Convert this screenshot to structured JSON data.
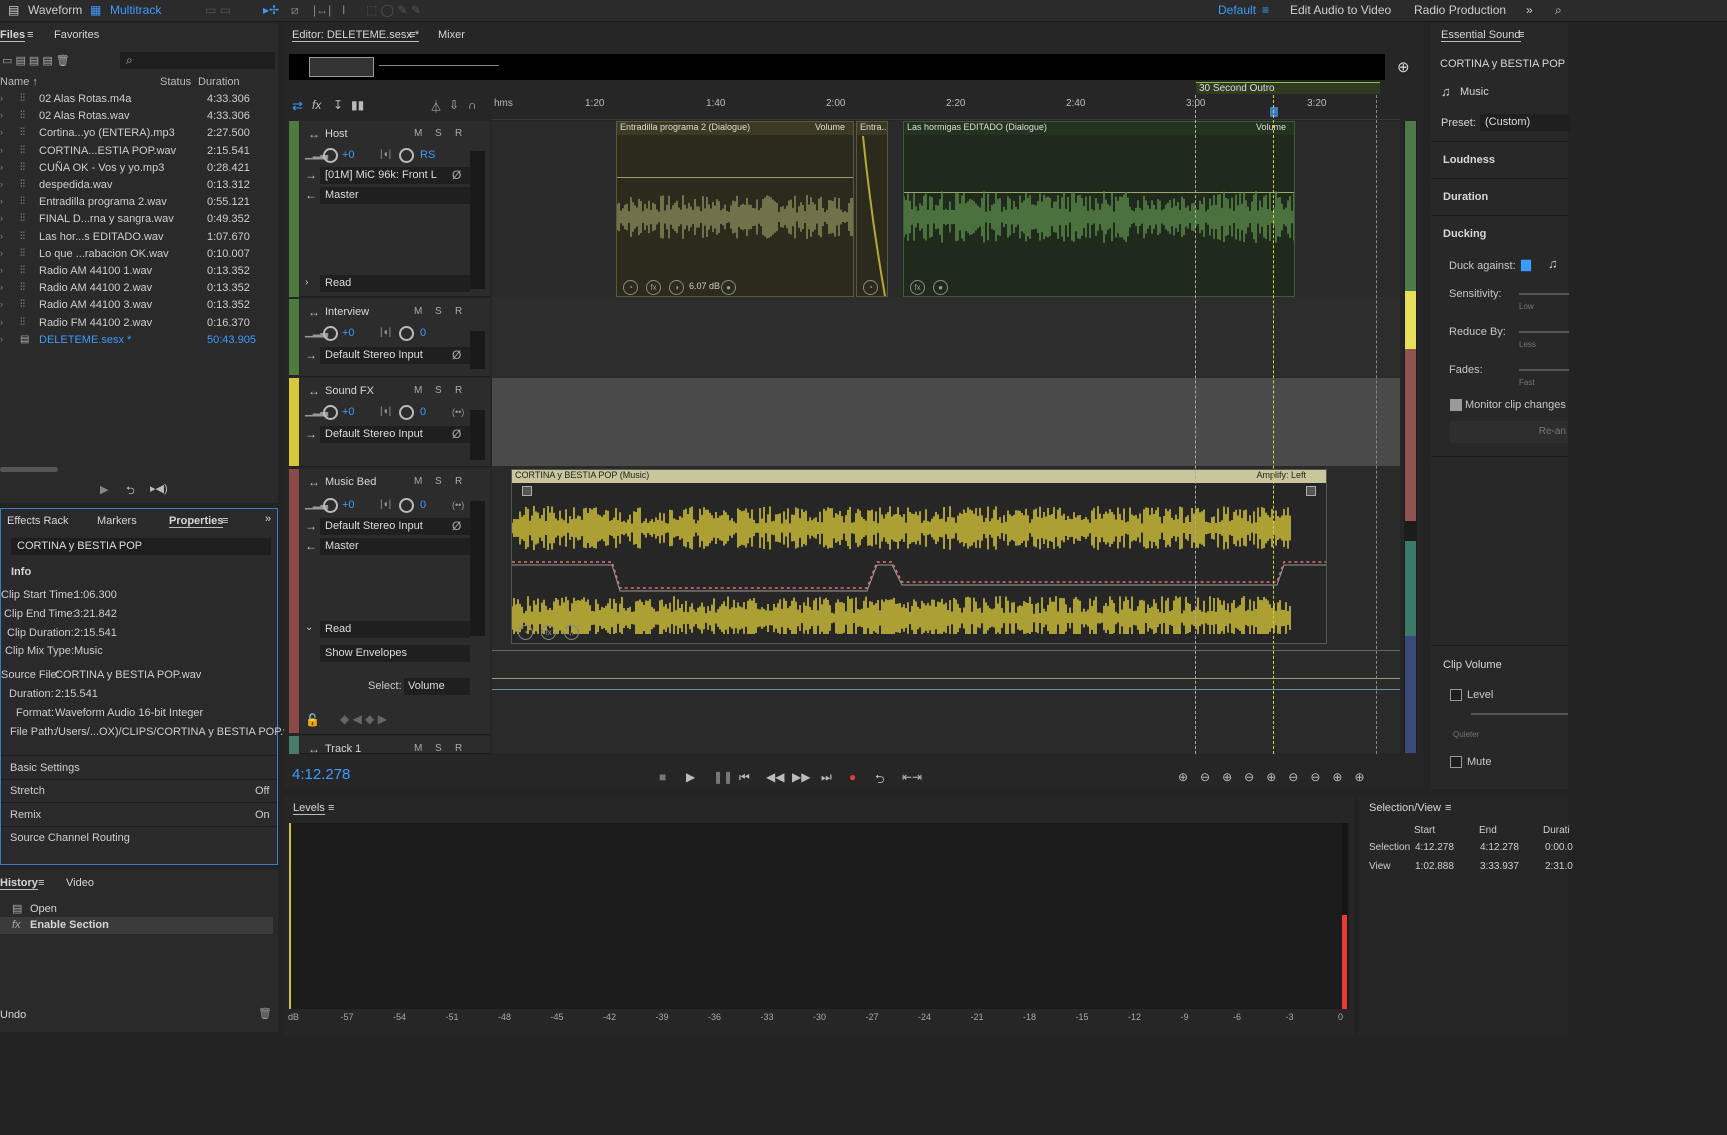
{
  "topbar": {
    "waveform": "Waveform",
    "multitrack": "Multitrack",
    "workspaces": [
      "Default",
      "Edit Audio to Video",
      "Radio Production"
    ]
  },
  "files": {
    "tab_files": "Files",
    "tab_favorites": "Favorites",
    "col_name": "Name ↑",
    "col_status": "Status",
    "col_duration": "Duration",
    "items": [
      {
        "name": "02 Alas Rotas.m4a",
        "dur": "4:33.306"
      },
      {
        "name": "02 Alas Rotas.wav",
        "dur": "4:33.306"
      },
      {
        "name": "Cortina...yo (ENTERA).mp3",
        "dur": "2:27.500"
      },
      {
        "name": "CORTINA...ESTIA POP.wav",
        "dur": "2:15.541"
      },
      {
        "name": "CUÑA OK - Vos y  yo.mp3",
        "dur": "0:28.421"
      },
      {
        "name": "despedida.wav",
        "dur": "0:13.312"
      },
      {
        "name": "Entradilla programa 2.wav",
        "dur": "0:55.121"
      },
      {
        "name": "FINAL D...rna y sangra.wav",
        "dur": "0:49.352"
      },
      {
        "name": "Las hor...s EDITADO.wav",
        "dur": "1:07.670"
      },
      {
        "name": "Lo que ...rabacion OK.wav",
        "dur": "0:10.007"
      },
      {
        "name": "Radio AM 44100 1.wav",
        "dur": "0:13.352"
      },
      {
        "name": "Radio AM 44100 2.wav",
        "dur": "0:13.352"
      },
      {
        "name": "Radio AM 44100 3.wav",
        "dur": "0:13.352"
      },
      {
        "name": "Radio FM 44100 2.wav",
        "dur": "0:16.370"
      },
      {
        "name": "DELETEME.sesx *",
        "dur": "50:43.905"
      }
    ]
  },
  "props": {
    "tab_effects": "Effects Rack",
    "tab_markers": "Markers",
    "tab_properties": "Properties",
    "clip_name": "CORTINA y BESTIA POP",
    "info": "Info",
    "start_label": "Clip Start Time:",
    "start": "1:06.300",
    "end_label": "Clip End Time:",
    "end": "3:21.842",
    "dur_label": "Clip Duration:",
    "dur": "2:15.541",
    "mix_label": "Clip Mix Type:",
    "mix": "Music",
    "src_label": "Source File:",
    "src": "CORTINA y BESTIA POP.wav",
    "sdur_label": "Duration:",
    "sdur": "2:15.541",
    "fmt_label": "Format:",
    "fmt": "Waveform Audio 16-bit Integer",
    "path_label": "File Path:",
    "path": "/Users/...OX)/CLIPS/CORTINA y BESTIA POP.wav",
    "basic": "Basic Settings",
    "stretch": "Stretch",
    "stretch_val": "Off",
    "remix": "Remix",
    "remix_val": "On",
    "routing": "Source Channel Routing"
  },
  "history": {
    "tab_history": "History",
    "tab_video": "Video",
    "items": [
      "Open",
      "Enable Section"
    ],
    "undo": "Undo"
  },
  "editor": {
    "tab_editor": "Editor: DELETEME.sesx *",
    "tab_mixer": "Mixer",
    "ruler": [
      "hms",
      "1:20",
      "1:40",
      "2:00",
      "2:20",
      "2:40",
      "3:00",
      "3:20"
    ],
    "marker": "30 Second Outro",
    "time": "4:12.278"
  },
  "tracks": [
    {
      "name": "Host",
      "vol": "+0",
      "pan": "RS",
      "input": "[01M] MiC 96k:  Front L",
      "output": "Master",
      "mode": "Read"
    },
    {
      "name": "Interview",
      "vol": "+0",
      "pan": "0",
      "input": "Default Stereo Input"
    },
    {
      "name": "Sound FX",
      "vol": "+0",
      "pan": "0",
      "input": "Default Stereo Input"
    },
    {
      "name": "Music Bed",
      "vol": "+0",
      "pan": "0",
      "input": "Default Stereo Input",
      "output": "Master",
      "mode": "Read",
      "envelopes": "Show Envelopes",
      "select_label": "Select:",
      "select": "Volume"
    },
    {
      "name": "Track 1"
    }
  ],
  "trackctrls": {
    "m": "M",
    "s": "S",
    "r": "R"
  },
  "clips": {
    "c1": {
      "title": "Entradilla programa 2 (Dialogue)",
      "param": "Volume",
      "db": "6.07 dB"
    },
    "c2": {
      "title": "Entra..."
    },
    "c3": {
      "title": "Las hormigas EDITADO (Dialogue)",
      "param": "Volume"
    },
    "c4": {
      "title": "CORTINA y BESTIA POP (Music)",
      "param": "Amplify: Left"
    }
  },
  "levels": {
    "title": "Levels",
    "ticks": [
      "dB",
      "-57",
      "-54",
      "-51",
      "-48",
      "-45",
      "-42",
      "-39",
      "-36",
      "-33",
      "-30",
      "-27",
      "-24",
      "-21",
      "-18",
      "-15",
      "-12",
      "-9",
      "-6",
      "-3",
      "0"
    ]
  },
  "selview": {
    "title": "Selection/View",
    "start": "Start",
    "end": "End",
    "dur": "Durati",
    "selection": "Selection",
    "view": "View",
    "sel_start": "4:12.278",
    "sel_end": "4:12.278",
    "sel_dur": "0:00.0",
    "view_start": "1:02.888",
    "view_end": "3:33.937",
    "view_dur": "2:31.0"
  },
  "essential": {
    "title": "Essential Sound",
    "clip": "CORTINA y BESTIA POP",
    "type": "Music",
    "preset_label": "Preset:",
    "preset": "(Custom)",
    "loudness": "Loudness",
    "duration": "Duration",
    "ducking": "Ducking",
    "duck_against": "Duck against:",
    "sensitivity": "Sensitivity:",
    "low": "Low",
    "reduce": "Reduce By:",
    "less": "Less",
    "fades": "Fades:",
    "fast": "Fast",
    "monitor": "Monitor clip changes",
    "rear": "Re-an",
    "clipvolume": "Clip Volume",
    "level": "Level",
    "quieter": "Quieter",
    "mute": "Mute"
  }
}
